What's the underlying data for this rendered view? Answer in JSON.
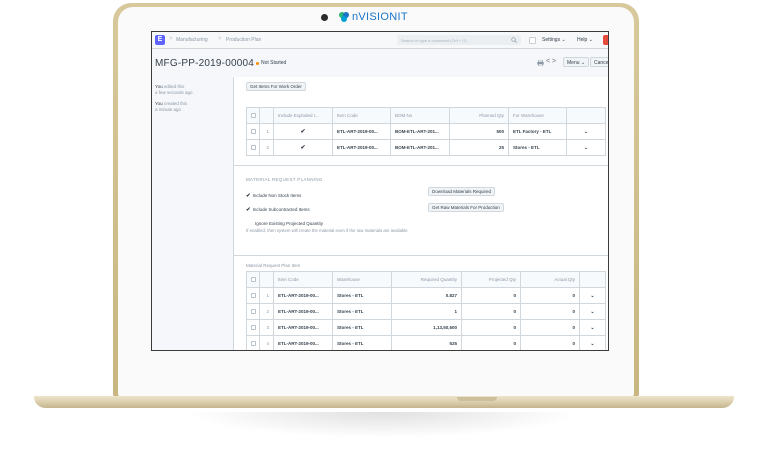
{
  "brand": {
    "name": "nVISIONIT",
    "color": "#1a75c9"
  },
  "navbar": {
    "app_icon_letter": "E",
    "breadcrumbs": [
      "Manufacturing",
      "Production Plan"
    ],
    "breadcrumb_sep": ">",
    "search_placeholder": "Search or type a command (Ctrl + G)",
    "settings_label": "Settings",
    "help_label": "Help"
  },
  "page": {
    "title": "MFG-PP-2019-00004",
    "status": "Not Started",
    "status_color": "#ff8a00",
    "pager": "< >",
    "menu_label": "Menu",
    "cancel_label": "Cancel"
  },
  "sidebar": {
    "edited_who": "You",
    "edited_rest": "edited this",
    "edited_when": "a few seconds ago",
    "created_who": "You",
    "created_rest": "created this",
    "created_when": "a minute ago"
  },
  "work_order": {
    "button_label": "Get Items For Work Order",
    "columns": [
      "",
      "",
      "Include Exploded I...",
      "Item Code",
      "BOM No",
      "Planned Qty",
      "For Warehouse",
      ""
    ],
    "rows": [
      {
        "idx": "1",
        "exploded": "✔",
        "item_code": "ETL-ART-2019-00...",
        "bom": "BOM-ETL-ART-201...",
        "qty": "500",
        "warehouse": "ETL Factory - ETL"
      },
      {
        "idx": "2",
        "exploded": "✔",
        "item_code": "ETL-ART-2019-00...",
        "bom": "BOM-ETL-ART-201...",
        "qty": "25",
        "warehouse": "Stores - ETL"
      }
    ]
  },
  "mrp": {
    "section_title": "MATERIAL REQUEST PLANNING",
    "include_non_stock": "Include Non Stock Items",
    "include_subcontracted": "Include Subcontracted Items",
    "ignore_projected": "Ignore Existing Projected Quantity",
    "help_text": "If enabled, then system will create the material even if the raw materials are available",
    "download_label": "Download Materials Required",
    "get_raw_label": "Get Raw Materials For Production"
  },
  "material_plan": {
    "label": "Material Request Plan Item",
    "columns": [
      "",
      "",
      "Item Code",
      "Warehouse",
      "Required Quantity",
      "Projected Qty",
      "Actual Qty",
      ""
    ],
    "rows": [
      {
        "idx": "1",
        "item_code": "ETL-ART-2019-00...",
        "warehouse": "Stores - ETL",
        "required": "0.827",
        "projected": "0",
        "actual": "0"
      },
      {
        "idx": "2",
        "item_code": "ETL-ART-2019-00...",
        "warehouse": "Stores - ETL",
        "required": "1",
        "projected": "0",
        "actual": "0"
      },
      {
        "idx": "3",
        "item_code": "ETL-ART-2019-00...",
        "warehouse": "Stores - ETL",
        "required": "1,13,50,500",
        "projected": "0",
        "actual": "0"
      },
      {
        "idx": "4",
        "item_code": "ETL-ART-2019-00...",
        "warehouse": "Stores - ETL",
        "required": "525",
        "projected": "0",
        "actual": "0"
      }
    ]
  },
  "icons": {
    "chevron": "⌄",
    "check": "✔"
  }
}
